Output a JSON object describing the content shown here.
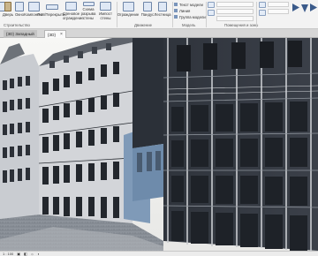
{
  "ribbon": {
    "buttons": [
      {
        "label": "Дверь"
      },
      {
        "label": "Окно"
      },
      {
        "label": "Компонент"
      },
      {
        "label": "Пол/Перекрытие"
      },
      {
        "label": "Стеновое ограждение"
      },
      {
        "label": "Схема разрыва стены"
      },
      {
        "label": "Импост стены"
      },
      {
        "label": "Ограждение"
      },
      {
        "label": "Пандус"
      },
      {
        "label": "Лестница"
      }
    ],
    "small_tools": [
      {
        "label": "Текст модели"
      },
      {
        "label": "Линия"
      },
      {
        "label": "Группа модели"
      }
    ],
    "groups": {
      "build": "Строительство",
      "circulation": "Движение",
      "model": "Модель",
      "rooms": "Помещения и зоны"
    }
  },
  "tabs": [
    {
      "label": "{3D} Западный",
      "active": false
    },
    {
      "label": "{3D}",
      "active": true
    }
  ],
  "status": {
    "scale": "1 : 100"
  },
  "colors": {
    "ribbon": "#f3f3f3",
    "tab_active": "#fafafa",
    "facade_dark": "#3a3f47",
    "glass": "#1f242b"
  }
}
